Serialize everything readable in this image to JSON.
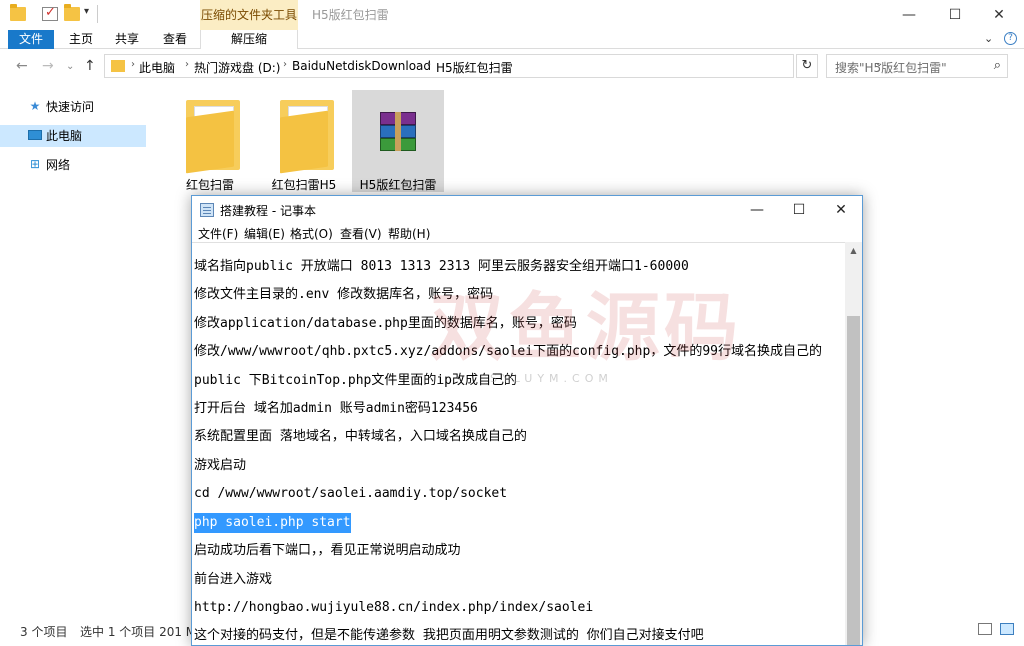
{
  "titlebar": {
    "context_tab": "压缩的文件夹工具",
    "title": "H5版红包扫雷",
    "minimize": "—",
    "maximize": "☐",
    "close": "✕"
  },
  "ribbon": {
    "tabs": [
      "文件",
      "主页",
      "共享",
      "查看",
      "解压缩"
    ],
    "collapse_icon": "chevron-down-icon",
    "help_icon": "question-icon"
  },
  "address": {
    "breadcrumbs": [
      "此电脑",
      "热门游戏盘 (D:)",
      "BaiduNetdiskDownload",
      "H5版红包扫雷"
    ],
    "search_placeholder": "搜索\"H5版红包扫雷\""
  },
  "navpane": {
    "items": [
      {
        "label": "快速访问",
        "icon": "pin-icon"
      },
      {
        "label": "此电脑",
        "icon": "computer-icon"
      },
      {
        "label": "网络",
        "icon": "network-icon"
      }
    ]
  },
  "files": [
    {
      "label": "红包扫雷",
      "type": "folder"
    },
    {
      "label": "红包扫雷H5",
      "type": "folder"
    },
    {
      "label": "H5版红包扫雷",
      "type": "rar-archive"
    }
  ],
  "statusbar": {
    "count": "3 个项目",
    "selected": "选中 1 个项目  201 MB"
  },
  "notepad": {
    "title": "搭建教程 - 记事本",
    "menu": [
      "文件(F)",
      "编辑(E)",
      "格式(O)",
      "查看(V)",
      "帮助(H)"
    ],
    "lines": [
      "域名指向public    开放端口  8013  1313  2313   阿里云服务器安全组开端口1-60000",
      "修改文件主目录的.env  修改数据库名，账号，密码",
      "修改application/database.php里面的数据库名，账号，密码",
      "修改/www/wwwroot/qhb.pxtc5.xyz/addons/saolei下面的config.php，文件的99行域名换成自己的",
      "public 下BitcoinTop.php文件里面的ip改成自己的",
      "打开后台  域名加admin    账号admin密码123456",
      "系统配置里面 落地域名，中转域名，入口域名换成自己的",
      "游戏启动",
      "cd /www/wwwroot/saolei.aamdiy.top/socket",
      "php saolei.php start",
      "启动成功后看下端口，，看见正常说明启动成功",
      "前台进入游戏",
      "http://hongbao.wujiyule88.cn/index.php/index/saolei",
      "这个对接的码支付，但是不能传递参数 我把页面用明文参数测试的 你们自己对接支付吧"
    ],
    "selected_line": "php saolei.php start"
  },
  "watermark": {
    "text": "双鱼源码",
    "sub": "SYLUYM.COM"
  }
}
